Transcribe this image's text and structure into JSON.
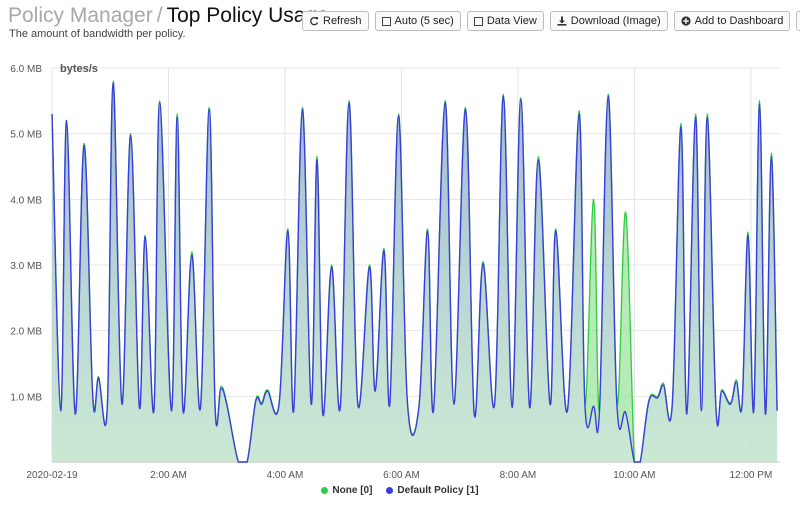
{
  "header": {
    "crumb": "Policy Manager",
    "separator": "/",
    "title": "Top Policy Usage",
    "subtitle": "The amount of bandwidth per policy."
  },
  "toolbar": {
    "refresh_label": "Refresh",
    "auto_label": "Auto (5 sec)",
    "data_view_label": "Data View",
    "download_label": "Download (Image)",
    "add_dashboard_label": "Add to Dashboard",
    "settings_label": "S"
  },
  "icons": {
    "refresh": "refresh-icon",
    "auto": "checkbox-icon",
    "data_view": "checkbox-icon",
    "download": "download-icon",
    "add_dashboard": "plus-circle-icon",
    "settings": "gear-icon"
  },
  "chart_data": {
    "type": "area",
    "ylabel": "bytes/s",
    "xlabel": "",
    "ylim": [
      0,
      6
    ],
    "y_unit": "MB",
    "yticks": [
      1,
      2,
      3,
      4,
      5,
      6
    ],
    "ytick_labels": [
      "1.0 MB",
      "2.0 MB",
      "3.0 MB",
      "4.0 MB",
      "5.0 MB",
      "6.0 MB"
    ],
    "xlim": [
      0,
      12.5
    ],
    "xticks": [
      0,
      2,
      4,
      6,
      8,
      10,
      12
    ],
    "xtick_labels": [
      "2020-02-19",
      "2:00 AM",
      "4:00 AM",
      "6:00 AM",
      "8:00 AM",
      "10:00 AM",
      "12:00 PM"
    ],
    "grid": true,
    "legend_position": "bottom",
    "x": [
      0.0,
      0.15,
      0.25,
      0.4,
      0.55,
      0.7,
      0.8,
      0.95,
      1.05,
      1.2,
      1.35,
      1.5,
      1.6,
      1.75,
      1.85,
      2.05,
      2.15,
      2.25,
      2.4,
      2.55,
      2.7,
      2.8,
      2.9,
      3.0,
      3.2,
      3.35,
      3.5,
      3.6,
      3.7,
      3.9,
      4.05,
      4.15,
      4.3,
      4.45,
      4.55,
      4.65,
      4.8,
      4.95,
      5.1,
      5.25,
      5.45,
      5.55,
      5.7,
      5.8,
      5.95,
      6.1,
      6.3,
      6.45,
      6.55,
      6.75,
      6.9,
      7.1,
      7.25,
      7.4,
      7.6,
      7.75,
      7.9,
      8.05,
      8.2,
      8.35,
      8.55,
      8.65,
      8.85,
      9.05,
      9.15,
      9.3,
      9.4,
      9.55,
      9.7,
      9.85,
      10.0,
      10.1,
      10.25,
      10.4,
      10.5,
      10.65,
      10.8,
      10.9,
      11.05,
      11.15,
      11.25,
      11.4,
      11.5,
      11.65,
      11.75,
      11.85,
      11.95,
      12.05,
      12.15,
      12.25,
      12.35,
      12.45
    ],
    "series": [
      {
        "name": "None [0]",
        "color": "#2ecc40",
        "values": [
          5.3,
          0.8,
          5.2,
          0.75,
          4.85,
          1.0,
          1.3,
          0.85,
          5.8,
          0.9,
          5.0,
          0.85,
          3.45,
          0.8,
          5.5,
          0.8,
          5.3,
          0.8,
          3.2,
          0.85,
          5.4,
          0.85,
          1.15,
          0.9,
          0.0,
          0.0,
          0.95,
          0.9,
          1.1,
          0.9,
          3.55,
          0.8,
          5.4,
          0.9,
          4.65,
          0.75,
          3.0,
          0.85,
          5.5,
          0.9,
          3.0,
          1.1,
          3.25,
          0.9,
          5.3,
          0.95,
          0.85,
          3.55,
          0.8,
          5.5,
          0.9,
          5.4,
          0.75,
          3.05,
          0.9,
          5.6,
          0.85,
          5.55,
          0.85,
          4.65,
          0.9,
          3.55,
          0.8,
          5.35,
          0.9,
          4.0,
          0.8,
          5.6,
          0.9,
          3.8,
          0.0,
          0.0,
          0.95,
          1.0,
          1.2,
          0.9,
          5.15,
          0.75,
          5.3,
          0.8,
          5.3,
          0.85,
          1.1,
          0.9,
          1.25,
          0.9,
          3.5,
          0.8,
          5.5,
          0.75,
          4.7,
          0.8,
          5.8,
          0.8,
          2.5,
          1.45
        ]
      },
      {
        "name": "Default Policy [1]",
        "color": "#3b3fd9",
        "values": [
          5.3,
          0.78,
          5.2,
          0.73,
          4.82,
          0.98,
          1.28,
          0.83,
          5.77,
          0.88,
          4.97,
          0.83,
          3.43,
          0.78,
          5.47,
          0.78,
          5.25,
          0.78,
          3.15,
          0.83,
          5.37,
          0.83,
          1.12,
          0.88,
          0.0,
          0.0,
          0.93,
          0.88,
          1.08,
          0.88,
          3.52,
          0.78,
          5.37,
          0.88,
          4.6,
          0.73,
          2.97,
          0.83,
          5.47,
          0.88,
          2.97,
          1.08,
          3.22,
          0.88,
          5.27,
          0.93,
          0.83,
          3.52,
          0.78,
          5.47,
          0.88,
          5.37,
          0.73,
          3.02,
          0.88,
          5.57,
          0.83,
          5.52,
          0.83,
          4.6,
          0.88,
          3.52,
          0.78,
          5.3,
          0.88,
          0.85,
          0.78,
          5.57,
          0.88,
          0.75,
          0.0,
          0.0,
          0.93,
          0.98,
          1.17,
          0.88,
          5.1,
          0.73,
          5.25,
          0.78,
          5.25,
          0.83,
          1.08,
          0.88,
          1.22,
          0.88,
          3.45,
          0.78,
          5.45,
          0.73,
          4.65,
          0.78,
          5.72,
          0.78,
          2.45,
          1.43
        ]
      }
    ]
  }
}
